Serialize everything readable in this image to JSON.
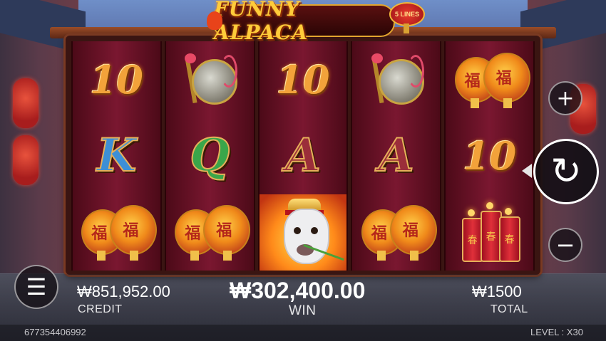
{
  "game": {
    "title": "FUNNY ALPACA",
    "lines_badge": "5 LINES"
  },
  "reels": [
    [
      "10",
      "K",
      "lanterns"
    ],
    [
      "gong",
      "Q",
      "lanterns"
    ],
    [
      "10",
      "A",
      "alpaca"
    ],
    [
      "gong",
      "A",
      "lanterns"
    ],
    [
      "lanterns",
      "10",
      "firecrackers"
    ]
  ],
  "symbols": {
    "ten": "10",
    "k": "K",
    "q": "Q",
    "a": "A",
    "lantern_char": "福",
    "firecracker_char": "春"
  },
  "controls": {
    "plus_label": "+",
    "minus_label": "−",
    "spin_label": "↻",
    "menu_label": "☰"
  },
  "stats": {
    "credit_value": "₩851,952.00",
    "credit_label": "CREDIT",
    "win_value": "₩302,400.00",
    "win_label": "WIN",
    "total_value": "₩1500",
    "total_label": "TOTAL"
  },
  "footer": {
    "session_id": "677354406992",
    "level_text": "LEVEL : X30"
  },
  "colors": {
    "accent_gold": "#f2a23a",
    "reel_bg": "#7a1730",
    "k_blue": "#3d8fd6",
    "q_green": "#3aa64a",
    "a_red": "#9b2e3a"
  }
}
